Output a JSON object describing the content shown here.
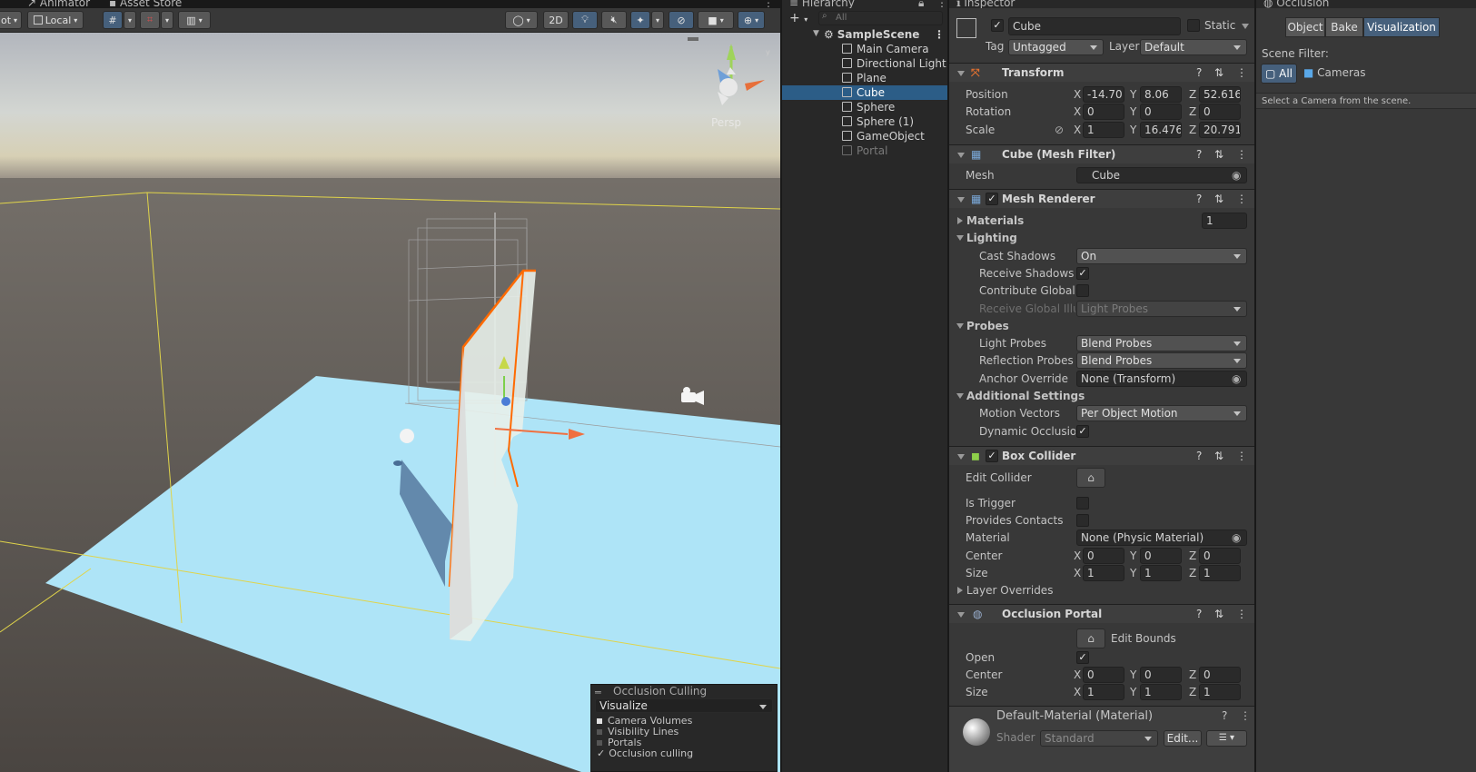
{
  "tabs": {
    "animator": "Animator",
    "asset_store": "Asset Store",
    "hierarchy": "Hierarchy",
    "inspector": "Inspector",
    "occlusion": "Occlusion"
  },
  "scene_toolbar": {
    "pivot_label": "ot",
    "local_label": "Local",
    "mode_2d": "2D",
    "persp_label": "Persp"
  },
  "occlusion_overlay": {
    "title": "Occlusion Culling",
    "mode": "Visualize",
    "options": [
      {
        "label": "Camera Volumes",
        "checked": false
      },
      {
        "label": "Visibility Lines",
        "checked": false
      },
      {
        "label": "Portals",
        "checked": false
      },
      {
        "label": "Occlusion culling",
        "checked": true
      }
    ]
  },
  "hierarchy": {
    "search_placeholder": "All",
    "scene": "SampleScene",
    "items": [
      "Main Camera",
      "Directional Light",
      "Plane",
      "Cube",
      "Sphere",
      "Sphere (1)",
      "GameObject",
      "Portal"
    ],
    "selected": "Cube"
  },
  "inspector": {
    "object_name": "Cube",
    "static_label": "Static",
    "tag_label": "Tag",
    "tag_value": "Untagged",
    "layer_label": "Layer",
    "layer_value": "Default",
    "transform": {
      "title": "Transform",
      "position_label": "Position",
      "position": [
        "-14.70",
        "8.06",
        "52.616"
      ],
      "rotation_label": "Rotation",
      "rotation": [
        "0",
        "0",
        "0"
      ],
      "scale_label": "Scale",
      "scale": [
        "1",
        "16.476",
        "20.791"
      ]
    },
    "mesh_filter": {
      "title": "Cube (Mesh Filter)",
      "mesh_label": "Mesh",
      "mesh_value": "Cube"
    },
    "mesh_renderer": {
      "title": "Mesh Renderer",
      "materials_label": "Materials",
      "materials_count": "1",
      "lighting_label": "Lighting",
      "cast_shadows_label": "Cast Shadows",
      "cast_shadows_value": "On",
      "receive_shadows_label": "Receive Shadows",
      "contribute_gi_label": "Contribute Global I",
      "receive_gi_label": "Receive Global Illu",
      "receive_gi_value": "Light Probes",
      "probes_label": "Probes",
      "light_probes_label": "Light Probes",
      "light_probes_value": "Blend Probes",
      "reflection_probes_label": "Reflection Probes",
      "reflection_probes_value": "Blend Probes",
      "anchor_override_label": "Anchor Override",
      "anchor_override_value": "None (Transform)",
      "additional_label": "Additional Settings",
      "motion_vectors_label": "Motion Vectors",
      "motion_vectors_value": "Per Object Motion",
      "dynamic_occlusion_label": "Dynamic Occlusion"
    },
    "box_collider": {
      "title": "Box Collider",
      "edit_collider_label": "Edit Collider",
      "is_trigger_label": "Is Trigger",
      "provides_contacts_label": "Provides Contacts",
      "material_label": "Material",
      "material_value": "None (Physic Material)",
      "center_label": "Center",
      "center": [
        "0",
        "0",
        "0"
      ],
      "size_label": "Size",
      "size": [
        "1",
        "1",
        "1"
      ],
      "layer_overrides_label": "Layer Overrides"
    },
    "occlusion_portal": {
      "title": "Occlusion Portal",
      "edit_bounds_label": "Edit Bounds",
      "open_label": "Open",
      "center_label": "Center",
      "center": [
        "0",
        "0",
        "0"
      ],
      "size_label": "Size",
      "size": [
        "1",
        "1",
        "1"
      ]
    },
    "material": {
      "name": "Default-Material (Material)",
      "shader_label": "Shader",
      "shader_value": "Standard",
      "edit_label": "Edit..."
    }
  },
  "occlusion": {
    "tabs": [
      "Object",
      "Bake",
      "Visualization"
    ],
    "active_tab": "Visualization",
    "scene_filter_label": "Scene Filter:",
    "filter_all": "All",
    "filter_cameras": "Cameras",
    "hint": "Select a Camera from the scene."
  },
  "colors": {
    "accent": "#2c5d87",
    "active_button": "#46607c",
    "selection_outline": "#ff6a00",
    "plane": "#aee4f7"
  }
}
